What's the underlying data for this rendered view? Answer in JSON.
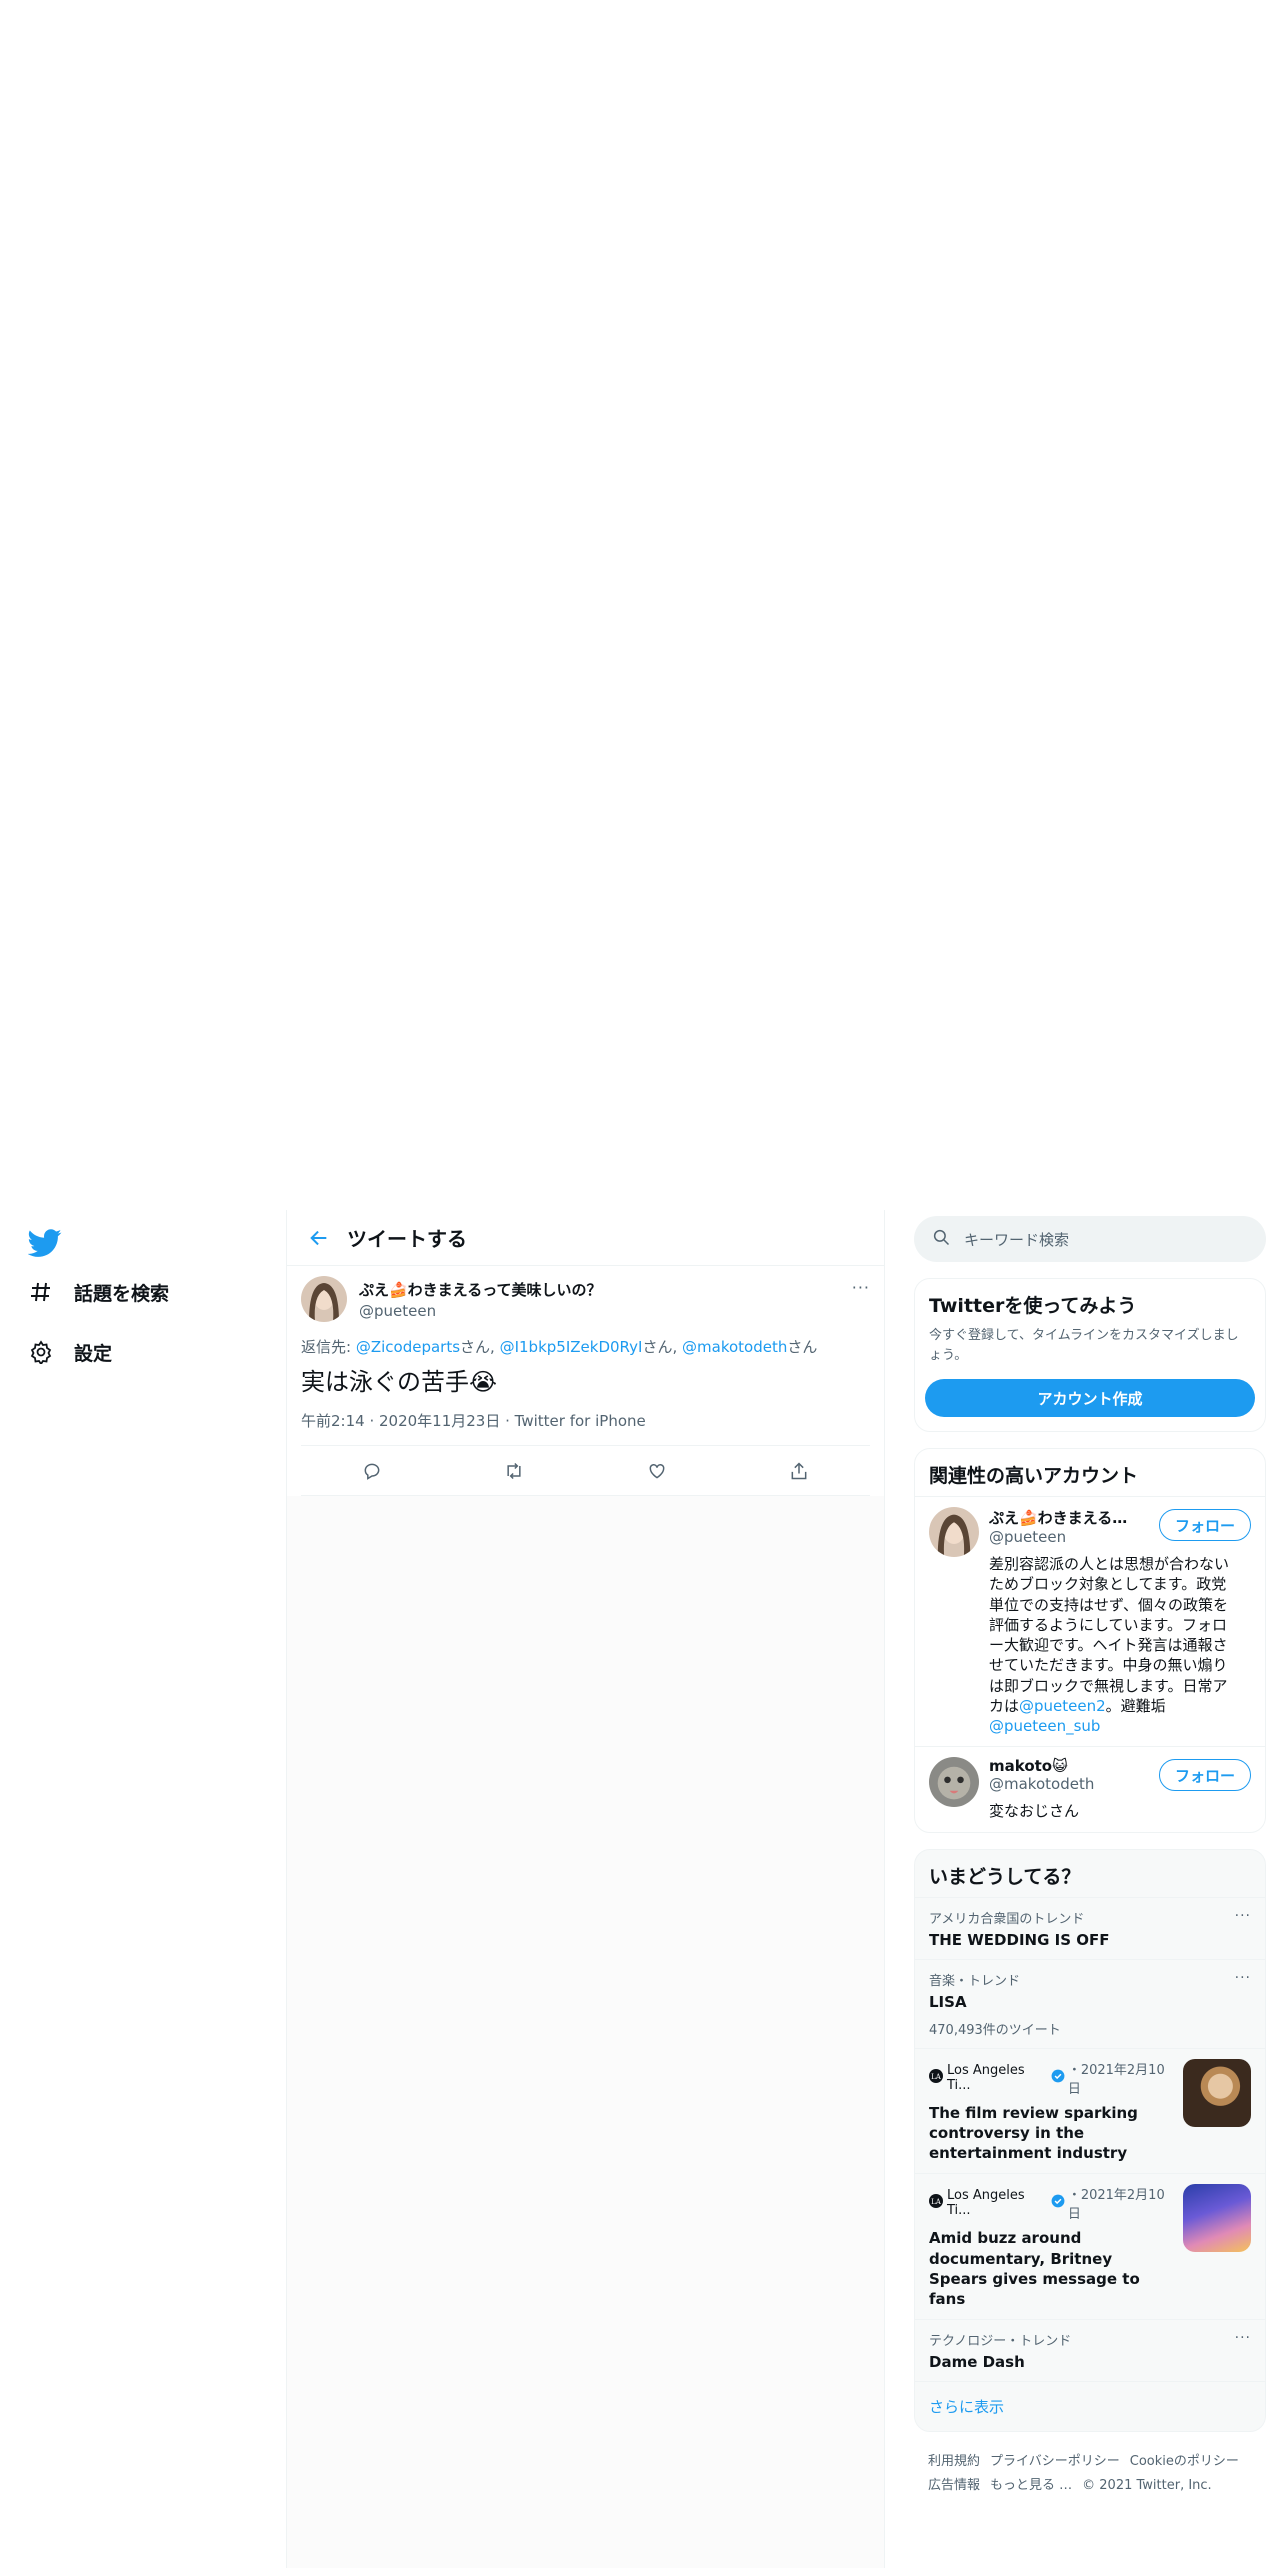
{
  "nav": {
    "items": [
      {
        "label": "話題を検索",
        "icon": "hashtag-icon"
      },
      {
        "label": "設定",
        "icon": "gear-icon"
      }
    ]
  },
  "header": {
    "title": "ツイートする"
  },
  "tweet": {
    "display_name": "ぷえ🍰わきまえるって美味しいの？",
    "handle": "@pueteen",
    "reply_prefix": "返信先: ",
    "reply_mentions": [
      "@Zicodeparts",
      "@I1bkp5IZekD0RyI",
      "@makotodeth"
    ],
    "reply_suffix": "さん",
    "text": "実は泳ぐの苦手😭",
    "time": "午前2:14",
    "date": "2020年11月23日",
    "source": "Twitter for iPhone"
  },
  "search": {
    "placeholder": "キーワード検索"
  },
  "signup_card": {
    "title": "Twitterを使ってみよう",
    "subtitle": "今すぐ登録して、タイムラインをカスタマイズしましょう。",
    "button": "アカウント作成"
  },
  "relevant": {
    "title": "関連性の高いアカウント",
    "follow_label": "フォロー",
    "accounts": [
      {
        "name": "ぷえ🍰わきまえるっ...",
        "handle": "@pueteen",
        "bio_text": "差別容認派の人とは思想が合わないためブロック対象としてます。政党単位での支持はせず、個々の政策を評価するようにしています。フォロー大歓迎です。ヘイト発言は通報させていただきます。中身の無い煽りは即ブロックで無視します。日常アカは",
        "bio_mention1": "@pueteen2",
        "bio_mid": "。避難垢 ",
        "bio_mention2": "@pueteen_sub"
      },
      {
        "name": "makoto😺",
        "handle": "@makotodeth",
        "bio_text": "変なおじさん"
      }
    ]
  },
  "whats_happening": {
    "title": "いまどうしてる？",
    "trends": [
      {
        "category": "アメリカ合衆国のトレンド",
        "name": "THE WEDDING IS OFF"
      },
      {
        "category": "音楽・トレンド",
        "name": "LISA",
        "count": "470,493件のツイート"
      }
    ],
    "news": [
      {
        "source": "Los Angeles Ti...",
        "date": "・2021年2月10日",
        "title": "The film review sparking controversy in the entertainment industry"
      },
      {
        "source": "Los Angeles Ti...",
        "date": "・2021年2月10日",
        "title": "Amid buzz around documentary, Britney Spears gives message to fans"
      }
    ],
    "trend_last": {
      "category": "テクノロジー・トレンド",
      "name": "Dame Dash"
    },
    "show_more": "さらに表示"
  },
  "footer": {
    "links": [
      "利用規約",
      "プライバシーポリシー",
      "Cookieのポリシー",
      "広告情報",
      "もっと見る …"
    ],
    "copyright": "© 2021 Twitter, Inc."
  },
  "colors": {
    "accent": "#1d9bf0",
    "text": "#0f1419",
    "muted": "#536471"
  }
}
